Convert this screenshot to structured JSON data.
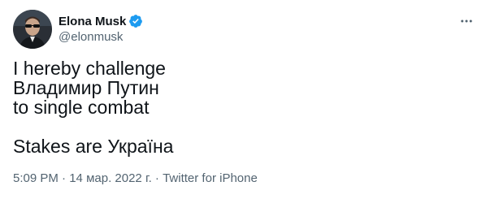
{
  "author": {
    "display_name": "Elona Musk",
    "handle": "@elonmusk",
    "verified_icon": "verified-badge-icon",
    "avatar_icon": "avatar-image"
  },
  "menu": {
    "more_icon": "more-dots-icon"
  },
  "tweet": {
    "lines": [
      "I hereby challenge",
      "Владимир Путин",
      "to single combat",
      "",
      "Stakes are Україна"
    ]
  },
  "meta": {
    "time": "5:09 PM",
    "separator": " · ",
    "date": "14 мар. 2022 г.",
    "source": "Twitter for iPhone"
  },
  "colors": {
    "verified": "#1d9bf0",
    "secondary_text": "#536471",
    "primary_text": "#0f1419"
  }
}
